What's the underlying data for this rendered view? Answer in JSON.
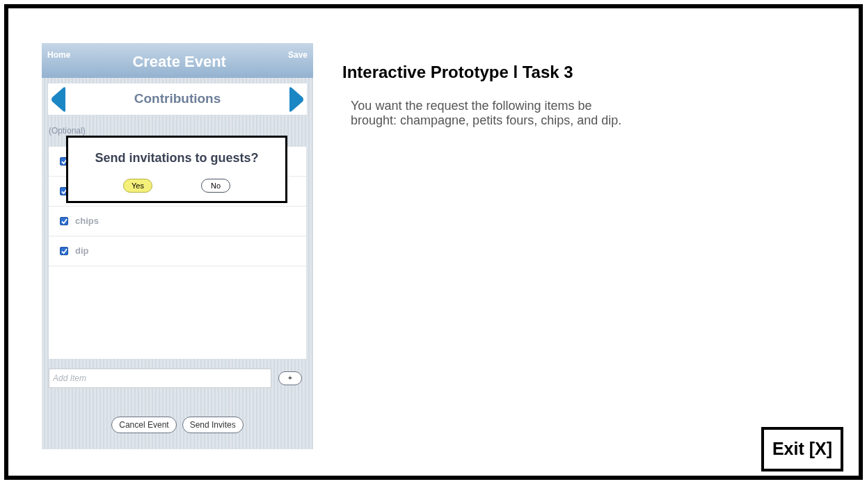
{
  "phone": {
    "nav": {
      "left": "Home",
      "title": "Create Event",
      "right": "Save"
    },
    "section": {
      "title": "Contributions"
    },
    "hint": "(Optional)",
    "items": [
      {
        "checked": true
      },
      {
        "checked": true
      },
      {
        "label": "chips",
        "checked": true
      },
      {
        "label": "dip",
        "checked": true
      }
    ],
    "add_field": {
      "placeholder": "Add Item"
    },
    "add_button": "+",
    "buttons": [
      "Cancel Event",
      "Send Invites"
    ],
    "dialog": {
      "question": "Send invitations to guests?",
      "options": [
        {
          "label": "Yes",
          "selected": true
        },
        {
          "label": "No",
          "selected": false
        }
      ]
    }
  },
  "task": {
    "title": "Interactive Prototype l Task 3",
    "description": "You want the request the following items be brought: champagne, petits fours, chips, and dip."
  },
  "exit_button": "Exit [X]"
}
